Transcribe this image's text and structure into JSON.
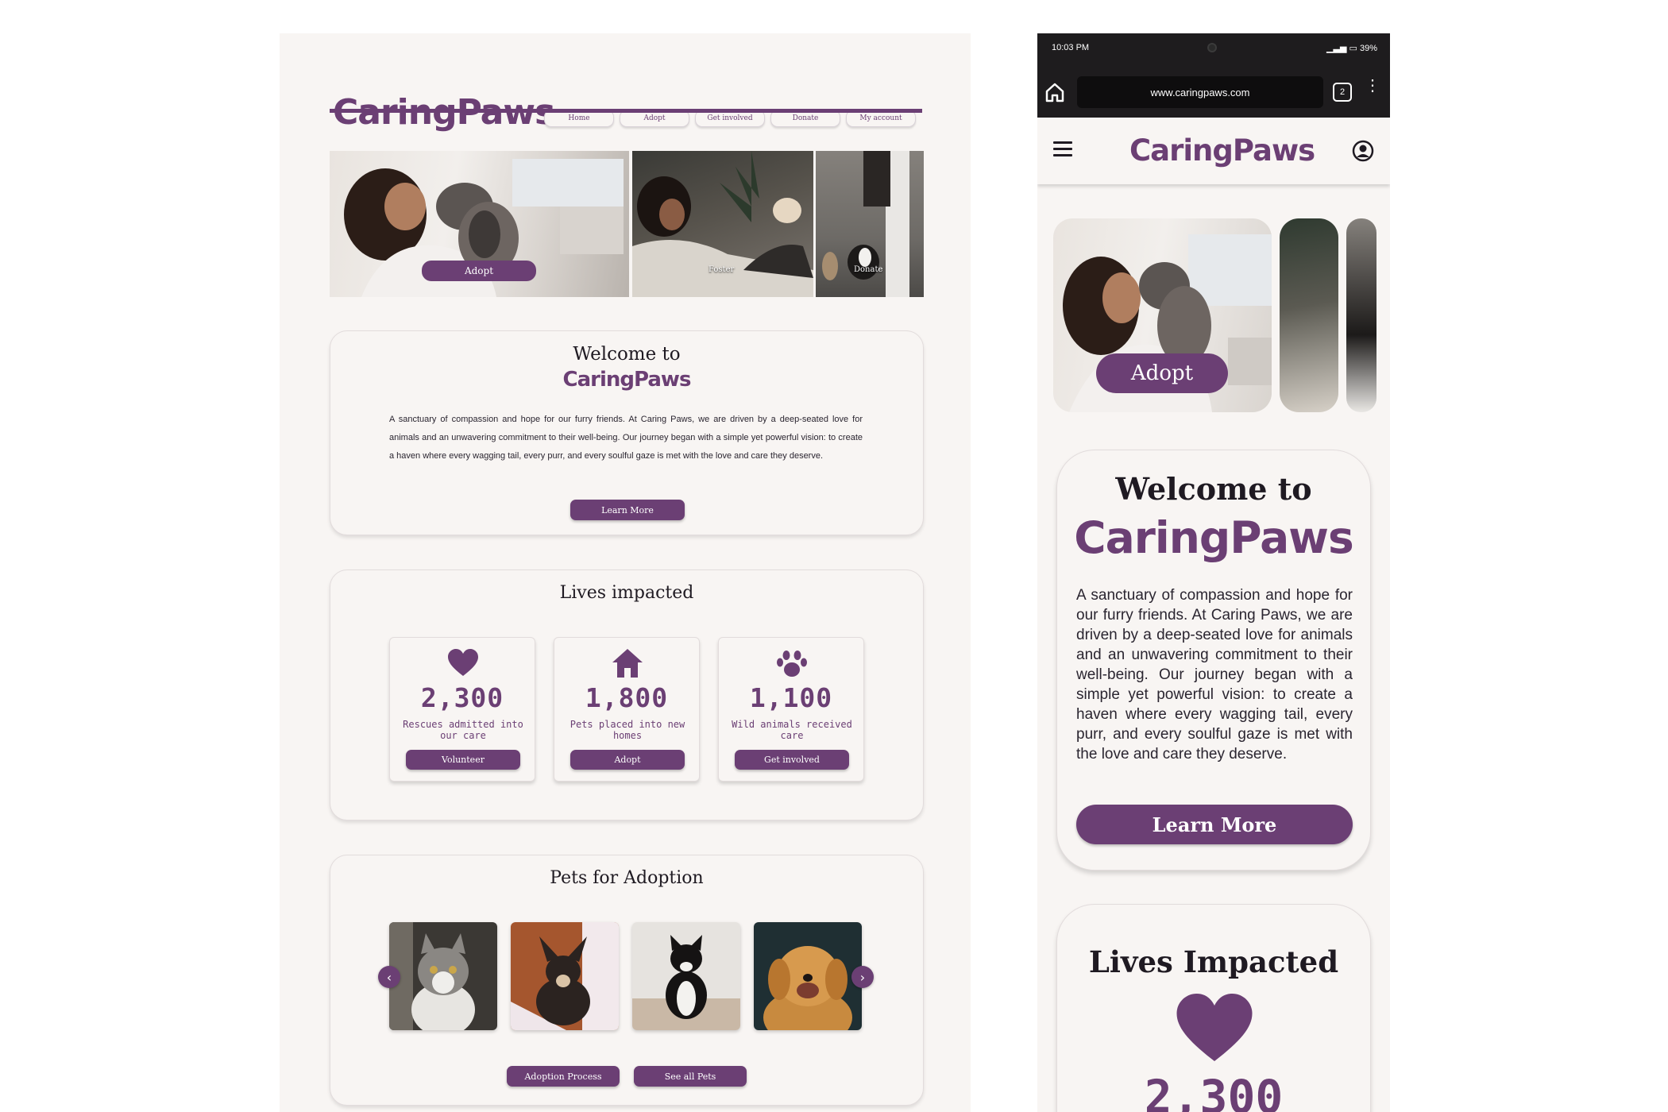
{
  "desktop": {
    "brand": "CaringPaws",
    "nav": [
      "Home",
      "Adopt",
      "Get involved",
      "Donate",
      "My account"
    ],
    "hero": [
      {
        "label": "Adopt"
      },
      {
        "label": "Foster"
      },
      {
        "label": "Donate"
      }
    ],
    "welcome": {
      "line1": "Welcome to",
      "brand": "CaringPaws",
      "body": "A sanctuary of compassion and hope for our furry friends. At Caring Paws, we are driven by a deep-seated love for animals and an unwavering commitment to their well-being. Our journey began with a simple yet powerful vision: to create a haven where every wagging tail, every purr, and every soulful gaze is met with the love and care they deserve.",
      "button": "Learn More"
    },
    "impact": {
      "title": "Lives impacted",
      "stats": [
        {
          "icon": "heart-icon",
          "number": "2,300",
          "label": "Rescues admitted into our care",
          "button": "Volunteer"
        },
        {
          "icon": "home-icon",
          "number": "1,800",
          "label": "Pets placed into new homes",
          "button": "Adopt"
        },
        {
          "icon": "paw-icon",
          "number": "1,100",
          "label": "Wild animals received care",
          "button": "Get involved"
        }
      ]
    },
    "pets": {
      "title": "Pets for Adoption",
      "buttons": [
        "Adoption Process",
        "See all Pets"
      ]
    }
  },
  "mobile": {
    "status": {
      "time": "10:03 PM",
      "battery": "39%"
    },
    "browser": {
      "url": "www.caringpaws.com",
      "tabs": "2"
    },
    "brand": "CaringPaws",
    "hero_label": "Adopt",
    "welcome": {
      "line1": "Welcome to",
      "brand": "CaringPaws",
      "body": "A sanctuary of compassion and hope for our furry friends. At Caring Paws, we are driven by a deep-seated love for animals and an unwavering commitment to their well-being. Our journey began with a simple yet powerful vision: to create a haven where every wagging tail, every purr, and every soulful gaze is met with the love and care they deserve.",
      "button": "Learn More"
    },
    "impact": {
      "title": "Lives Impacted",
      "number": "2,300"
    }
  },
  "colors": {
    "accent": "#6b3f74",
    "background": "#f8f5f3",
    "status_bar": "#1e1c1e"
  }
}
